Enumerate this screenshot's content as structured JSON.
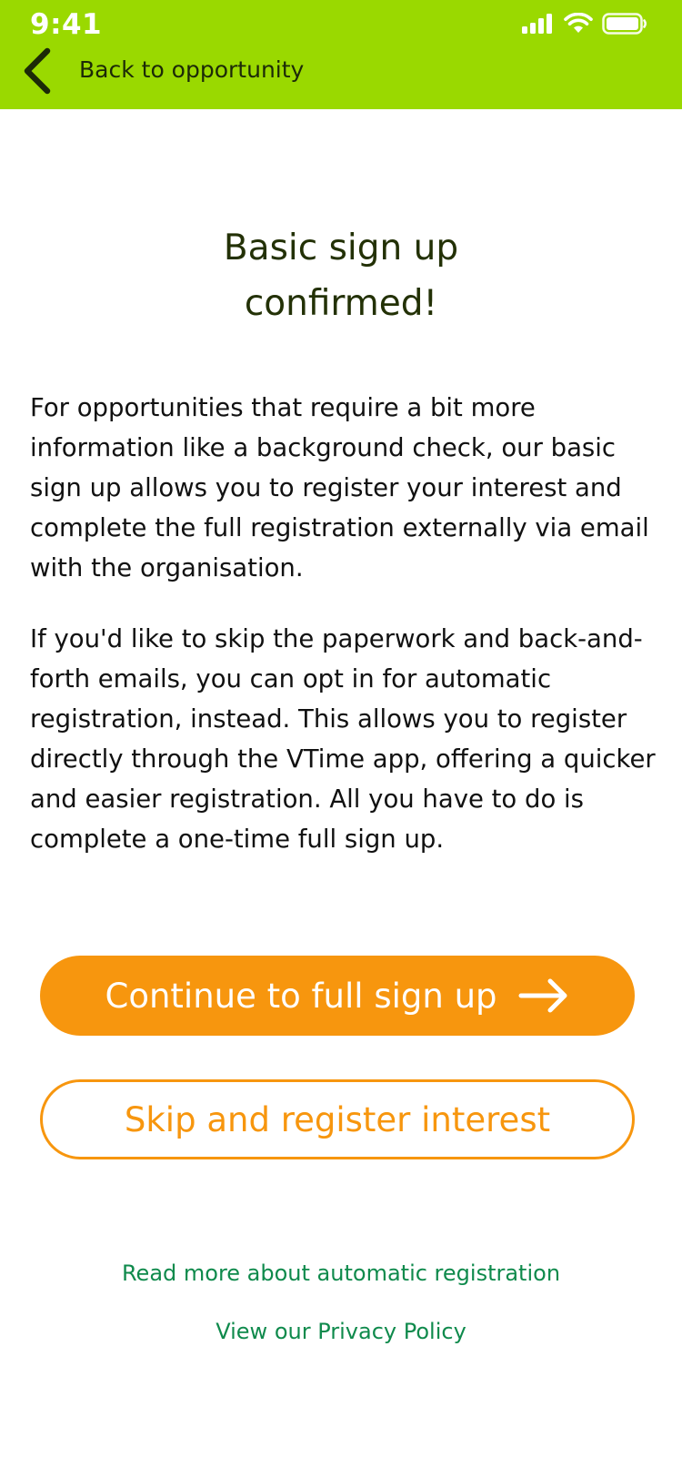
{
  "status_bar": {
    "time": "9:41",
    "icons": [
      "cellular-signal-icon",
      "wifi-icon",
      "battery-icon"
    ]
  },
  "nav": {
    "back_label": "Back to opportunity",
    "back_icon": "chevron-left-icon"
  },
  "main": {
    "title_line1": "Basic sign up",
    "title_line2": "confirmed!",
    "paragraph1": "For opportunities that require a bit more information like a background check, our basic sign up allows you to register your interest and complete the full registration externally via email with the organisation.",
    "paragraph2": "If you'd like to skip the paperwork and back-and-forth emails, you can opt in for automatic registration, instead. This allows you to register directly through the VTime app, offering a quicker and easier registration. All you have to do is complete a one-time full sign up."
  },
  "actions": {
    "primary_label": "Continue to full sign up",
    "primary_icon": "arrow-right-icon",
    "secondary_label": "Skip and register interest"
  },
  "links": {
    "automatic_registration": "Read more about automatic registration",
    "privacy_policy": "View our Privacy Policy"
  },
  "colors": {
    "header_bg": "#9ad900",
    "accent_orange": "#f7960e",
    "link_green": "#0f8a4c",
    "title_color": "#233106"
  }
}
